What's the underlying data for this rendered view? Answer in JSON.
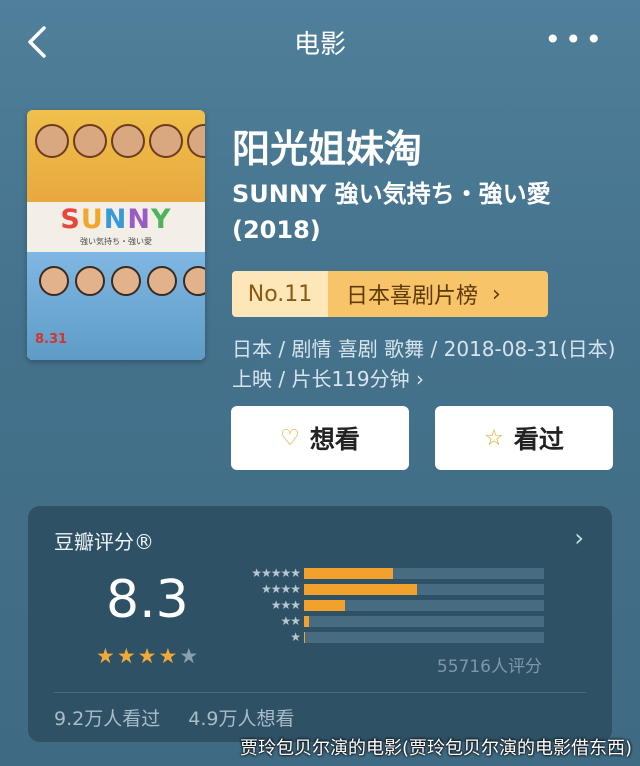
{
  "header": {
    "title": "电影"
  },
  "movie": {
    "title_cn": "阳光姐妹淘",
    "title_orig": "SUNNY 強い気持ち・強い愛 (2018)",
    "rank": {
      "no": "No.11",
      "chart": "日本喜剧片榜"
    },
    "meta": "日本 / 剧情 喜剧 歌舞 / 2018-08-31(日本)上映 / 片长119分钟",
    "poster": {
      "logo": "SUNNY",
      "subtitle": "強い気持ち・強い愛",
      "date": "8.31"
    }
  },
  "actions": {
    "want": "想看",
    "seen": "看过"
  },
  "rating": {
    "title": "豆瓣评分®",
    "score": "8.3",
    "stars": 4,
    "distribution": [
      {
        "label": "★★★★★",
        "value": 0.37
      },
      {
        "label": "★★★★",
        "value": 0.47
      },
      {
        "label": "★★★",
        "value": 0.17
      },
      {
        "label": "★★",
        "value": 0.02
      },
      {
        "label": "★",
        "value": 0.005
      }
    ],
    "count": "55716人评分",
    "seen": "9.2万人看过",
    "want": "4.9万人想看"
  },
  "watermark": "贾玲包贝尔演的电影(贾玲包贝尔演的电影借东西)"
}
